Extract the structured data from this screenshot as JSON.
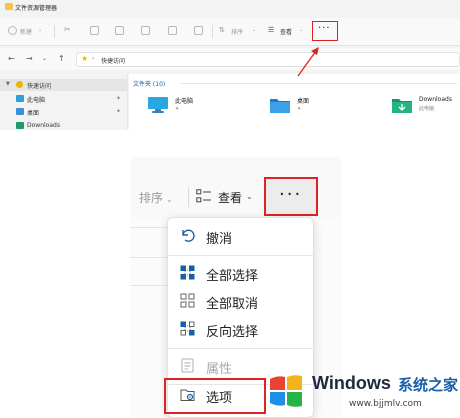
{
  "window": {
    "title": "文件资源管理器"
  },
  "commandbar": {
    "new_label": "新建",
    "sort_label": "排序",
    "view_label": "查看",
    "more_label": "···"
  },
  "addressbar": {
    "path": "快捷访问"
  },
  "navpane": {
    "items": [
      {
        "label": "快速访问",
        "icon": "star-icon"
      },
      {
        "label": "此电脑",
        "icon": "computer-icon"
      },
      {
        "label": "桌面",
        "icon": "desktop-icon"
      },
      {
        "label": "Downloads",
        "icon": "download-icon"
      }
    ]
  },
  "content": {
    "group_header": "文件夹 (10)",
    "folders": [
      {
        "name": "此电脑",
        "sub": "",
        "icon": "computer-icon"
      },
      {
        "name": "桌面",
        "sub": "",
        "icon": "desktop-folder-icon"
      },
      {
        "name": "Downloads",
        "sub": "此电脑",
        "icon": "download-folder-icon"
      }
    ]
  },
  "zoom_toolbar": {
    "sort_label": "排序",
    "view_label": "查看",
    "more_label": "···"
  },
  "menu": {
    "items": [
      {
        "label": "撤消",
        "icon": "undo-icon",
        "enabled": true
      },
      {
        "label": "全部选择",
        "icon": "select-all-icon",
        "enabled": true
      },
      {
        "label": "全部取消",
        "icon": "select-none-icon",
        "enabled": true
      },
      {
        "label": "反向选择",
        "icon": "invert-selection-icon",
        "enabled": true
      },
      {
        "label": "属性",
        "icon": "properties-icon",
        "enabled": false
      },
      {
        "label": "选项",
        "icon": "options-icon",
        "enabled": true
      }
    ]
  },
  "watermark": {
    "brand": "Windows",
    "cn": "系统之家",
    "url": "www.bjjmlv.com"
  },
  "colors": {
    "highlight_red": "#dd2222",
    "link_blue": "#1a5ea8",
    "folder_yellow": "#f4c542"
  }
}
